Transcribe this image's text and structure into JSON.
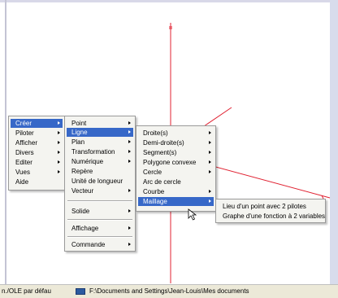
{
  "main_menu": {
    "items": [
      {
        "label": "Créer",
        "submenu": true,
        "selected": true
      },
      {
        "label": "Piloter",
        "submenu": true
      },
      {
        "label": "Afficher",
        "submenu": true
      },
      {
        "label": "Divers",
        "submenu": true
      },
      {
        "label": "Editer",
        "submenu": true
      },
      {
        "label": "Vues",
        "submenu": true
      },
      {
        "label": "Aide",
        "submenu": false
      }
    ]
  },
  "creer_menu": {
    "items": [
      {
        "label": "Point",
        "submenu": true
      },
      {
        "label": "Ligne",
        "submenu": true,
        "selected": true
      },
      {
        "label": "Plan",
        "submenu": true
      },
      {
        "label": "Transformation",
        "submenu": true
      },
      {
        "label": "Numérique",
        "submenu": true
      },
      {
        "label": "Repère",
        "submenu": false
      },
      {
        "label": "Unité de longueur",
        "submenu": false
      },
      {
        "label": "Vecteur",
        "submenu": true
      },
      {
        "label": "Solide",
        "submenu": true
      },
      {
        "label": "Affichage",
        "submenu": true
      },
      {
        "label": "Commande",
        "submenu": true
      }
    ]
  },
  "ligne_menu": {
    "items": [
      {
        "label": "Droite(s)",
        "submenu": true
      },
      {
        "label": "Demi-droite(s)",
        "submenu": true
      },
      {
        "label": "Segment(s)",
        "submenu": true
      },
      {
        "label": "Polygone convexe",
        "submenu": true
      },
      {
        "label": "Cercle",
        "submenu": true
      },
      {
        "label": "Arc de cercle",
        "submenu": false
      },
      {
        "label": "Courbe",
        "submenu": true
      },
      {
        "label": "Maillage",
        "submenu": true,
        "selected": true
      }
    ]
  },
  "maillage_menu": {
    "items": [
      {
        "label": "Lieu d'un point avec 2 pilotes"
      },
      {
        "label": "Graphe d'une fonction à 2 variables"
      }
    ]
  },
  "statusbar": {
    "left_text": "n./OLE par défau",
    "path_text": "F:\\Documents and Settings\\Jean-Louis\\Mes documents"
  },
  "colors": {
    "selection": "#3768c8",
    "axis": "#e02030",
    "statusbar_bg": "#ece9d8"
  }
}
